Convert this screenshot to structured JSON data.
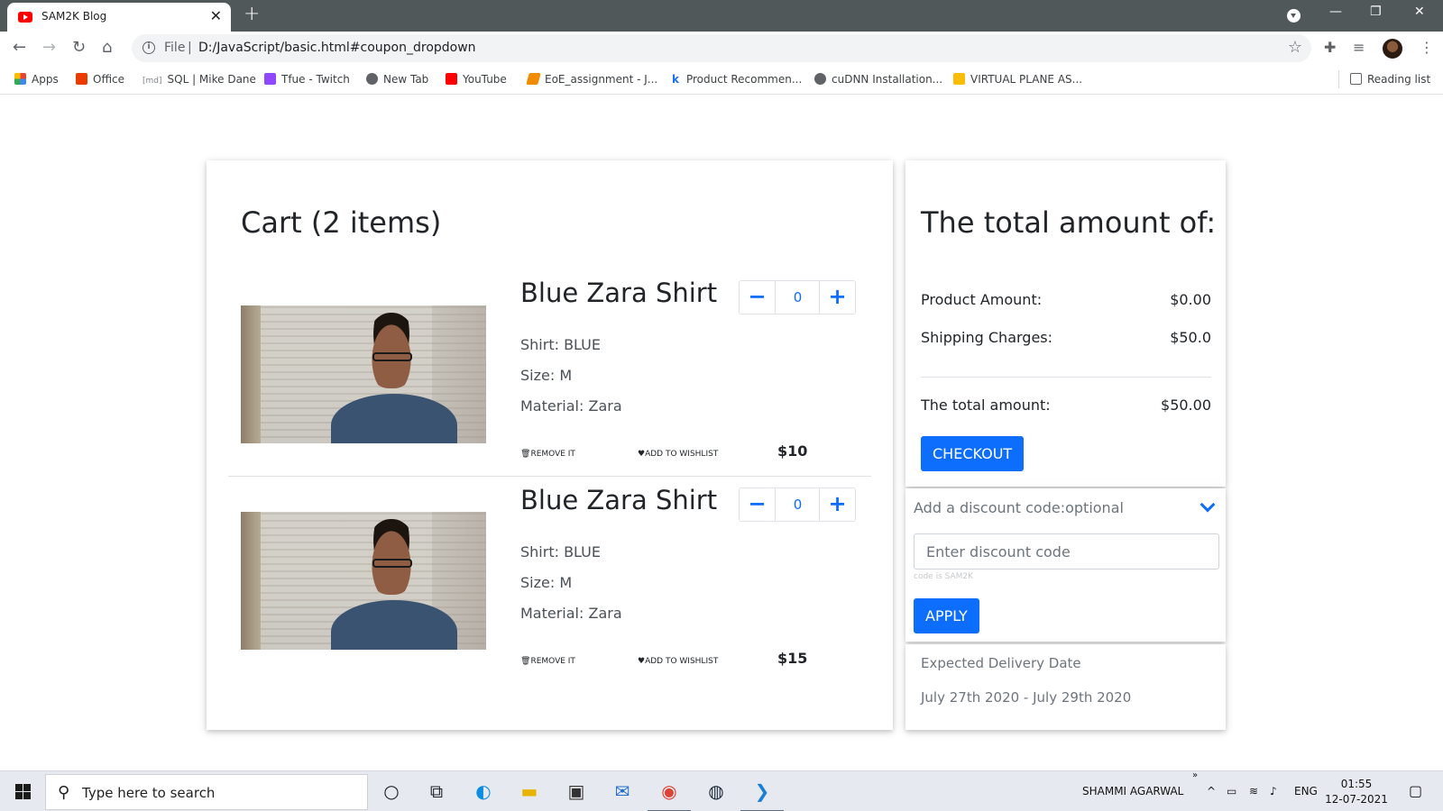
{
  "browser": {
    "tab_title": "SAM2K Blog",
    "new_tab_label": "+",
    "address_scheme": "File",
    "address_url": "D:/JavaScript/basic.html#coupon_dropdown",
    "bookmarks": [
      {
        "label": "Apps",
        "color": "#ea4335"
      },
      {
        "label": "Office",
        "color": "#eb3c00"
      },
      {
        "label": "SQL | Mike Dane",
        "color": "#9aa0a6"
      },
      {
        "label": "Tfue - Twitch",
        "color": "#9146ff"
      },
      {
        "label": "New Tab",
        "color": "#5f6368"
      },
      {
        "label": "YouTube",
        "color": "#ff0000"
      },
      {
        "label": "EoE_assignment - J...",
        "color": "#f28b00"
      },
      {
        "label": "Product Recommen...",
        "color": "#1a73e8"
      },
      {
        "label": "cuDNN Installation...",
        "color": "#5f6368"
      },
      {
        "label": "VIRTUAL PLANE AS...",
        "color": "#fbbc04"
      }
    ],
    "bookmark_prefix_md": "[md]",
    "reading_list": "Reading list"
  },
  "cart": {
    "title": "Cart (2 items)",
    "items": [
      {
        "name": "Blue Zara Shirt",
        "quantity": "0",
        "shirt": "Shirt: BLUE",
        "size": "Size: M",
        "material": "Material: Zara",
        "remove_label": "Remove it",
        "wishlist_label": "Add to wishlist",
        "price": "$10"
      },
      {
        "name": "Blue Zara Shirt",
        "quantity": "0",
        "shirt": "Shirt: BLUE",
        "size": "Size: M",
        "material": "Material: Zara",
        "remove_label": "Remove it",
        "wishlist_label": "Add to wishlist",
        "price": "$15"
      }
    ],
    "minus_label": "−",
    "plus_label": "+"
  },
  "summary": {
    "title": "The total amount of:",
    "product_amount_label": "Product Amount:",
    "product_amount_value": "$0.00",
    "shipping_label": "Shipping Charges:",
    "shipping_value": "$50.0",
    "total_label": "The total amount:",
    "total_value": "$50.00",
    "checkout_label": "Checkout"
  },
  "discount": {
    "heading": "Add a discount code:optional",
    "placeholder": "Enter discount code",
    "hint": "code is SAM2K",
    "apply_label": "Apply"
  },
  "delivery": {
    "label": "Expected Delivery Date",
    "date_range": "July 27th 2020 - July 29th 2020"
  },
  "taskbar": {
    "search_placeholder": "Type here to search",
    "user_name": "SHAMMI AGARWAL",
    "language": "ENG",
    "time": "01:55",
    "date": "12-07-2021"
  },
  "colors": {
    "accent": "#0d6efd",
    "titlebar": "#50585a"
  }
}
